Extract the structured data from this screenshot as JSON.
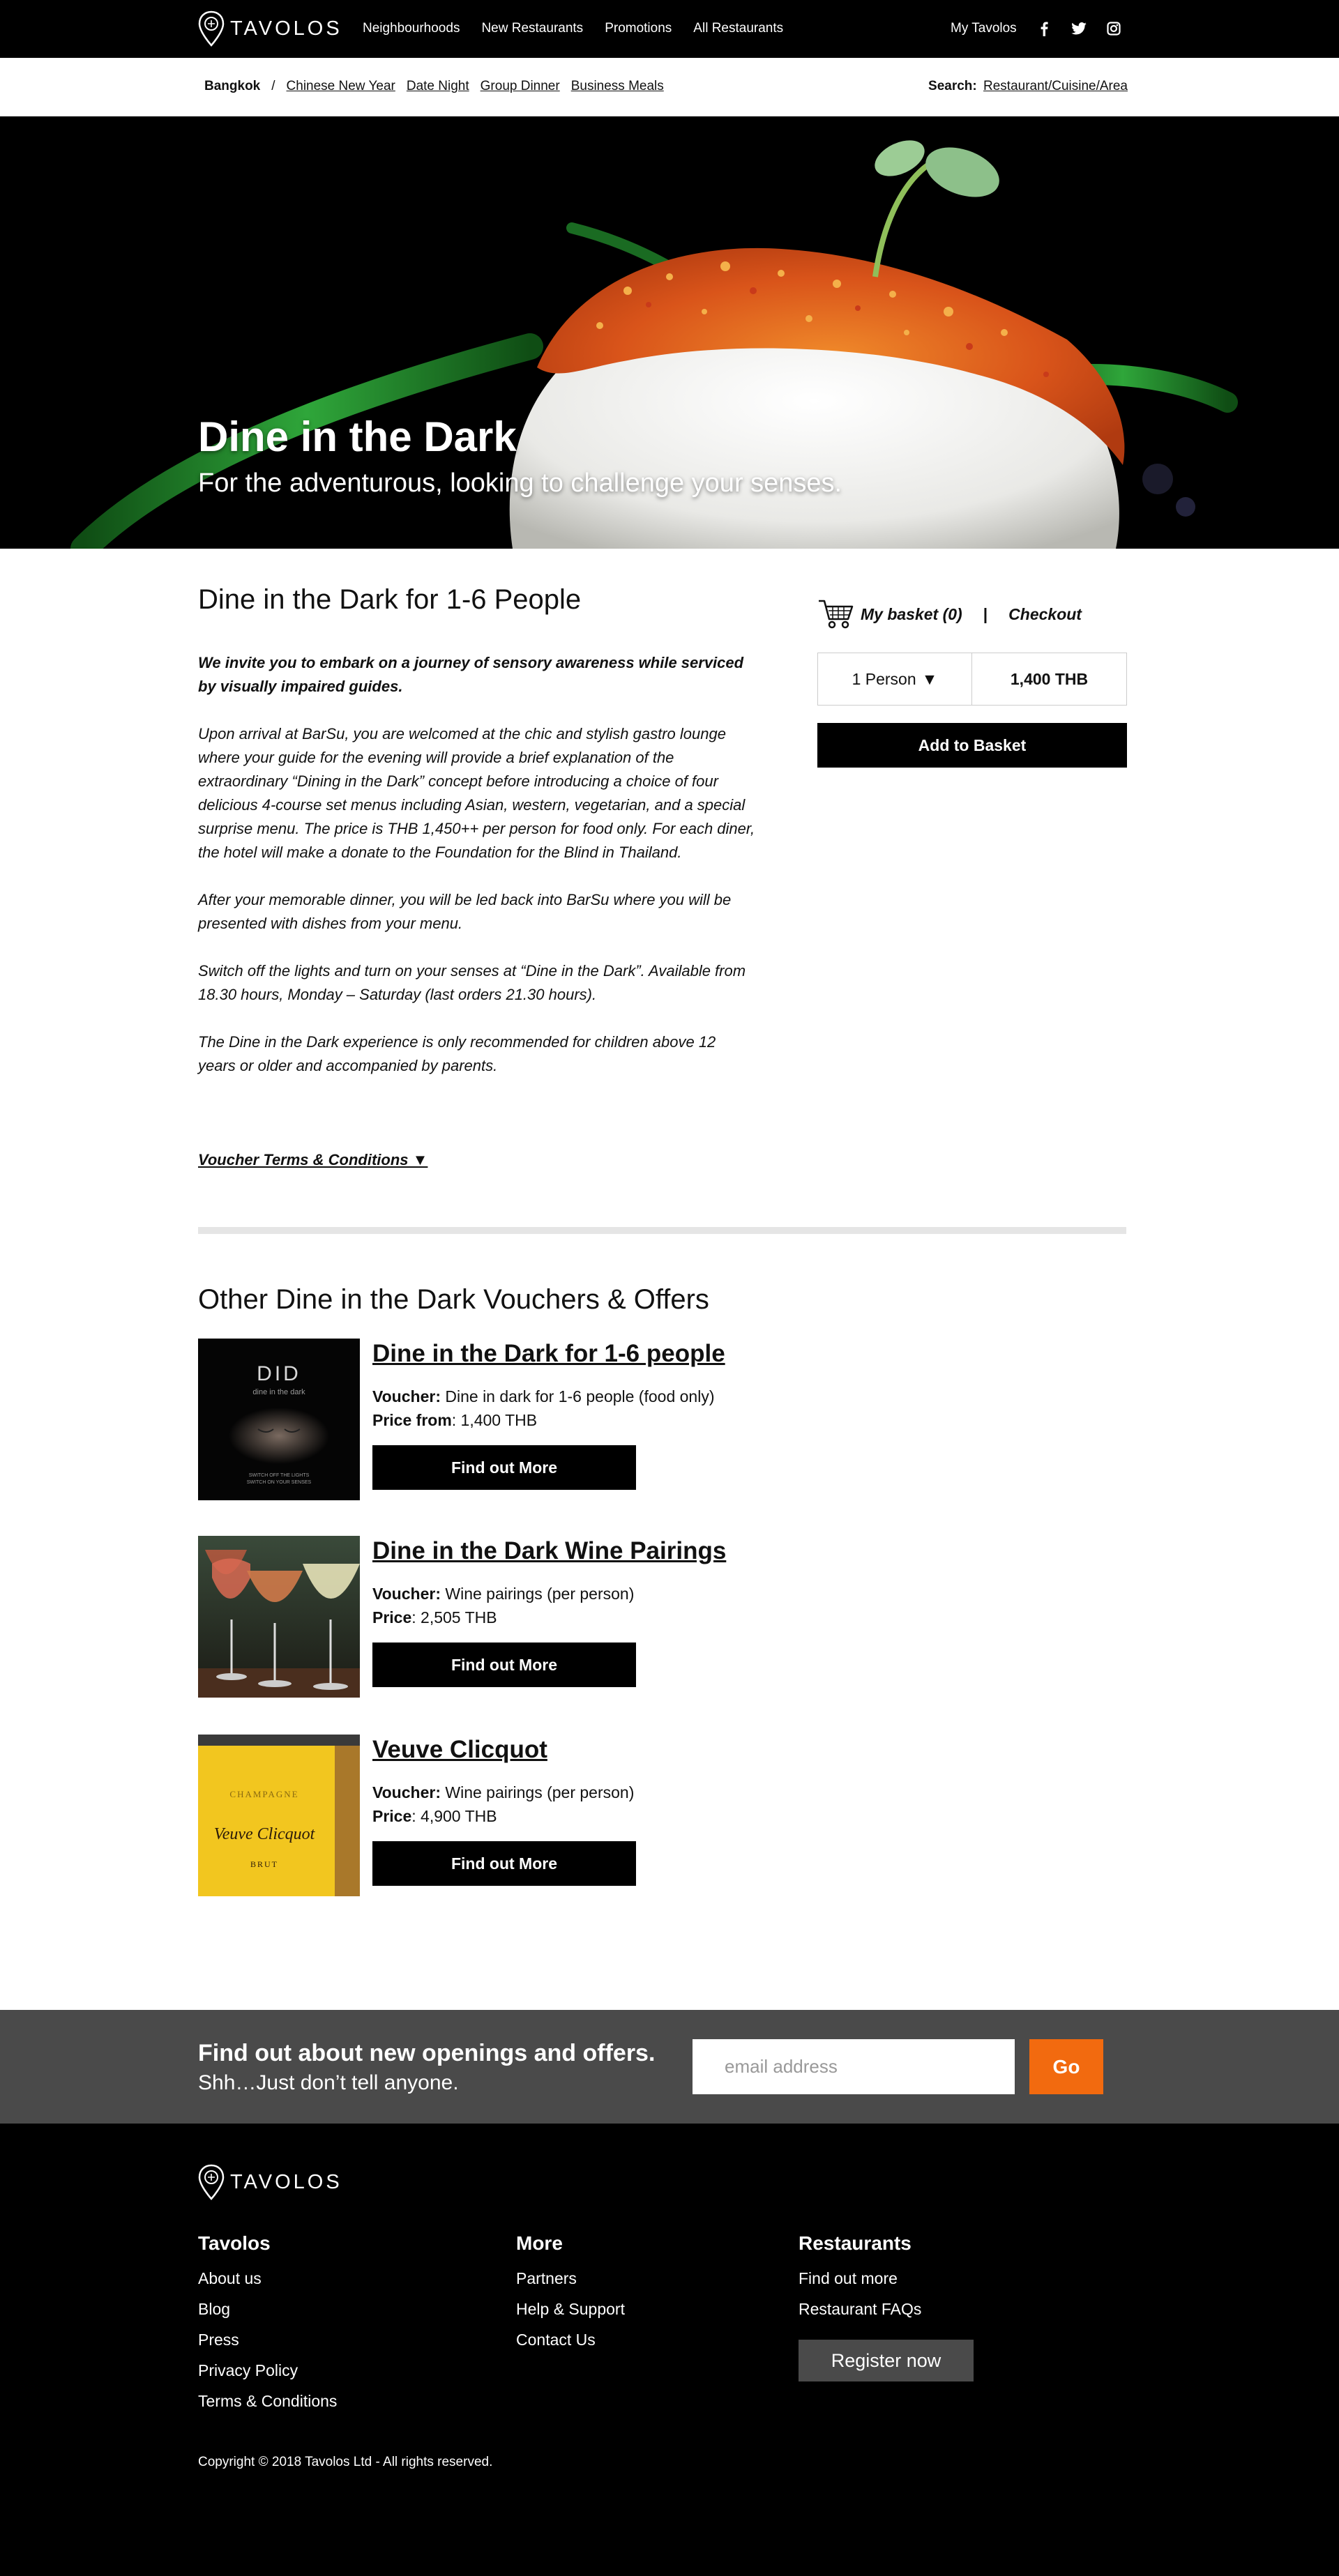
{
  "brand": {
    "name": "TAVOLOS"
  },
  "topnav": {
    "links": [
      "Neighbourhoods",
      "New Restaurants",
      "Promotions",
      "All Restaurants"
    ],
    "my_account": "My Tavolos"
  },
  "subnav": {
    "city": "Bangkok",
    "separator": "/",
    "tags": [
      "Chinese New Year",
      "Date Night",
      "Group Dinner",
      "Business Meals"
    ],
    "search_label": "Search:",
    "search_link": "Restaurant/Cuisine/Area"
  },
  "hero": {
    "title": "Dine in the Dark",
    "subtitle": "For the adventurous, looking to challenge your senses."
  },
  "main": {
    "title": "Dine in the Dark for 1-6 People",
    "lead": "We invite you to embark on a journey of sensory awareness while serviced by visually impaired guides.",
    "paragraphs": [
      "Upon arrival at BarSu, you are welcomed at the chic and stylish gastro lounge where your guide for the evening will provide a brief explanation of the extraordinary “Dining in the Dark” concept before introducing a choice of four delicious 4-course set menus including Asian, western, vegetarian, and a special surprise menu. The price is THB 1,450++ per person for food only. For each diner, the hotel will make a donate to the Foundation for the Blind in Thailand.",
      "After your memorable dinner, you will be led back into BarSu where you will be presented with dishes from your menu.",
      "Switch off the lights and turn on your senses at “Dine in the Dark”. Available from 18.30 hours, Monday – Saturday (last orders 21.30 hours).",
      "The Dine in the Dark experience is only recommended for children above 12 years or older and accompanied by parents."
    ],
    "terms_label": "Voucher Terms & Conditions ▼"
  },
  "basket": {
    "my_basket": "My basket (0)",
    "separator": "|",
    "checkout": "Checkout",
    "people_value": "1 Person",
    "people_arrow": "▼",
    "price": "1,400 THB",
    "add_label": "Add to Basket"
  },
  "others": {
    "title": "Other Dine in the Dark Vouchers & Offers",
    "items": [
      {
        "title": "Dine in the Dark for 1-6 people",
        "line1_label": "Voucher:",
        "line1_value": " Dine in dark for 1-6 people (food only)",
        "line2_label": "Price from",
        "line2_value": ": 1,400 THB",
        "button": "Find out More",
        "thumb_text_big": "DID",
        "thumb_text_small": "dine in the dark",
        "thumb_text_foot1": "SWITCH OFF THE LIGHTS",
        "thumb_text_foot2": "SWITCH ON YOUR SENSES"
      },
      {
        "title": "Dine in the Dark Wine Pairings",
        "line1_label": "Voucher:",
        "line1_value": " Wine pairings (per person)",
        "line2_label": "Price",
        "line2_value": ": 2,505 THB",
        "button": "Find out More"
      },
      {
        "title": "Veuve Clicquot",
        "line1_label": "Voucher:",
        "line1_value": " Wine pairings (per person)",
        "line2_label": "Price",
        "line2_value": ": 4,900 THB",
        "button": "Find out More",
        "thumb_text_1": "CHAMPAGNE",
        "thumb_text_2": "Veuve Clicquot",
        "thumb_text_3": "BRUT"
      }
    ]
  },
  "newsletter": {
    "title": "Find out about new openings and offers.",
    "subtitle": "Shh…Just don’t tell anyone.",
    "placeholder": "email address",
    "go": "Go"
  },
  "footer": {
    "col1": {
      "heading": "Tavolos",
      "links": [
        "About us",
        "Blog",
        "Press",
        "Privacy Policy",
        "Terms & Conditions"
      ]
    },
    "col2": {
      "heading": "More",
      "links": [
        "Partners",
        "Help & Support",
        "Contact Us"
      ]
    },
    "col3": {
      "heading": "Restaurants",
      "links": [
        "Find out more",
        "Restaurant FAQs"
      ],
      "register": "Register now"
    },
    "copyright": "Copyright © 2018 Tavolos Ltd  - All rights reserved."
  },
  "colors": {
    "accent": "#f26a0f",
    "dark": "#000000",
    "band": "#4a4a4a"
  },
  "icons": [
    "facebook-icon",
    "twitter-icon",
    "instagram-icon",
    "cart-icon",
    "logo-pin-icon"
  ]
}
